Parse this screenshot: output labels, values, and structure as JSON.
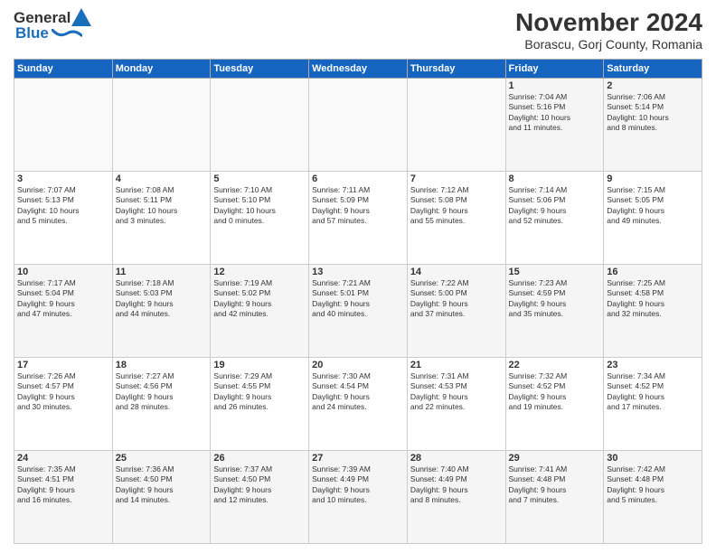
{
  "header": {
    "logo_general": "General",
    "logo_blue": "Blue",
    "title": "November 2024",
    "subtitle": "Borascu, Gorj County, Romania"
  },
  "calendar": {
    "weekdays": [
      "Sunday",
      "Monday",
      "Tuesday",
      "Wednesday",
      "Thursday",
      "Friday",
      "Saturday"
    ],
    "weeks": [
      [
        {
          "day": "",
          "info": ""
        },
        {
          "day": "",
          "info": ""
        },
        {
          "day": "",
          "info": ""
        },
        {
          "day": "",
          "info": ""
        },
        {
          "day": "",
          "info": ""
        },
        {
          "day": "1",
          "info": "Sunrise: 7:04 AM\nSunset: 5:16 PM\nDaylight: 10 hours\nand 11 minutes."
        },
        {
          "day": "2",
          "info": "Sunrise: 7:06 AM\nSunset: 5:14 PM\nDaylight: 10 hours\nand 8 minutes."
        }
      ],
      [
        {
          "day": "3",
          "info": "Sunrise: 7:07 AM\nSunset: 5:13 PM\nDaylight: 10 hours\nand 5 minutes."
        },
        {
          "day": "4",
          "info": "Sunrise: 7:08 AM\nSunset: 5:11 PM\nDaylight: 10 hours\nand 3 minutes."
        },
        {
          "day": "5",
          "info": "Sunrise: 7:10 AM\nSunset: 5:10 PM\nDaylight: 10 hours\nand 0 minutes."
        },
        {
          "day": "6",
          "info": "Sunrise: 7:11 AM\nSunset: 5:09 PM\nDaylight: 9 hours\nand 57 minutes."
        },
        {
          "day": "7",
          "info": "Sunrise: 7:12 AM\nSunset: 5:08 PM\nDaylight: 9 hours\nand 55 minutes."
        },
        {
          "day": "8",
          "info": "Sunrise: 7:14 AM\nSunset: 5:06 PM\nDaylight: 9 hours\nand 52 minutes."
        },
        {
          "day": "9",
          "info": "Sunrise: 7:15 AM\nSunset: 5:05 PM\nDaylight: 9 hours\nand 49 minutes."
        }
      ],
      [
        {
          "day": "10",
          "info": "Sunrise: 7:17 AM\nSunset: 5:04 PM\nDaylight: 9 hours\nand 47 minutes."
        },
        {
          "day": "11",
          "info": "Sunrise: 7:18 AM\nSunset: 5:03 PM\nDaylight: 9 hours\nand 44 minutes."
        },
        {
          "day": "12",
          "info": "Sunrise: 7:19 AM\nSunset: 5:02 PM\nDaylight: 9 hours\nand 42 minutes."
        },
        {
          "day": "13",
          "info": "Sunrise: 7:21 AM\nSunset: 5:01 PM\nDaylight: 9 hours\nand 40 minutes."
        },
        {
          "day": "14",
          "info": "Sunrise: 7:22 AM\nSunset: 5:00 PM\nDaylight: 9 hours\nand 37 minutes."
        },
        {
          "day": "15",
          "info": "Sunrise: 7:23 AM\nSunset: 4:59 PM\nDaylight: 9 hours\nand 35 minutes."
        },
        {
          "day": "16",
          "info": "Sunrise: 7:25 AM\nSunset: 4:58 PM\nDaylight: 9 hours\nand 32 minutes."
        }
      ],
      [
        {
          "day": "17",
          "info": "Sunrise: 7:26 AM\nSunset: 4:57 PM\nDaylight: 9 hours\nand 30 minutes."
        },
        {
          "day": "18",
          "info": "Sunrise: 7:27 AM\nSunset: 4:56 PM\nDaylight: 9 hours\nand 28 minutes."
        },
        {
          "day": "19",
          "info": "Sunrise: 7:29 AM\nSunset: 4:55 PM\nDaylight: 9 hours\nand 26 minutes."
        },
        {
          "day": "20",
          "info": "Sunrise: 7:30 AM\nSunset: 4:54 PM\nDaylight: 9 hours\nand 24 minutes."
        },
        {
          "day": "21",
          "info": "Sunrise: 7:31 AM\nSunset: 4:53 PM\nDaylight: 9 hours\nand 22 minutes."
        },
        {
          "day": "22",
          "info": "Sunrise: 7:32 AM\nSunset: 4:52 PM\nDaylight: 9 hours\nand 19 minutes."
        },
        {
          "day": "23",
          "info": "Sunrise: 7:34 AM\nSunset: 4:52 PM\nDaylight: 9 hours\nand 17 minutes."
        }
      ],
      [
        {
          "day": "24",
          "info": "Sunrise: 7:35 AM\nSunset: 4:51 PM\nDaylight: 9 hours\nand 16 minutes."
        },
        {
          "day": "25",
          "info": "Sunrise: 7:36 AM\nSunset: 4:50 PM\nDaylight: 9 hours\nand 14 minutes."
        },
        {
          "day": "26",
          "info": "Sunrise: 7:37 AM\nSunset: 4:50 PM\nDaylight: 9 hours\nand 12 minutes."
        },
        {
          "day": "27",
          "info": "Sunrise: 7:39 AM\nSunset: 4:49 PM\nDaylight: 9 hours\nand 10 minutes."
        },
        {
          "day": "28",
          "info": "Sunrise: 7:40 AM\nSunset: 4:49 PM\nDaylight: 9 hours\nand 8 minutes."
        },
        {
          "day": "29",
          "info": "Sunrise: 7:41 AM\nSunset: 4:48 PM\nDaylight: 9 hours\nand 7 minutes."
        },
        {
          "day": "30",
          "info": "Sunrise: 7:42 AM\nSunset: 4:48 PM\nDaylight: 9 hours\nand 5 minutes."
        }
      ]
    ]
  }
}
